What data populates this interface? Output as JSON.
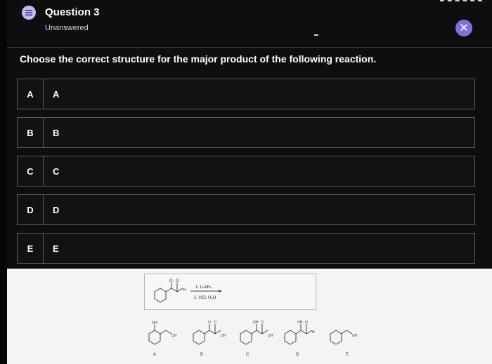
{
  "header": {
    "title": "Question 3",
    "status": "Unanswered"
  },
  "question": {
    "prompt": "Choose the correct structure for the major product of the following reaction."
  },
  "choices": [
    {
      "letter": "A",
      "label": "A"
    },
    {
      "letter": "B",
      "label": "B"
    },
    {
      "letter": "C",
      "label": "C"
    },
    {
      "letter": "D",
      "label": "D"
    },
    {
      "letter": "E",
      "label": "E"
    }
  ],
  "reaction": {
    "reagent1": "1. LiAlH₄",
    "reagent2": "2. HCl, H₂O"
  },
  "answer_structures": [
    {
      "label": "A",
      "groups": [
        "OH",
        "OH"
      ]
    },
    {
      "label": "B",
      "groups": [
        "O",
        "O",
        "OH"
      ]
    },
    {
      "label": "C",
      "groups": [
        "OH",
        "O",
        "OH"
      ]
    },
    {
      "label": "D",
      "groups": [
        "OH",
        "O",
        "H"
      ]
    },
    {
      "label": "E",
      "groups": [
        "OH"
      ]
    }
  ],
  "structure_labels": {
    "o": "O",
    "h": "H",
    "oh": "OH"
  },
  "colors": {
    "background": "#0e0e10",
    "accent": "#7a74d6",
    "question_icon": "#c9b6f2",
    "border": "#5a5a62"
  },
  "icons": {
    "question": "question-list-icon",
    "close": "close-icon"
  }
}
